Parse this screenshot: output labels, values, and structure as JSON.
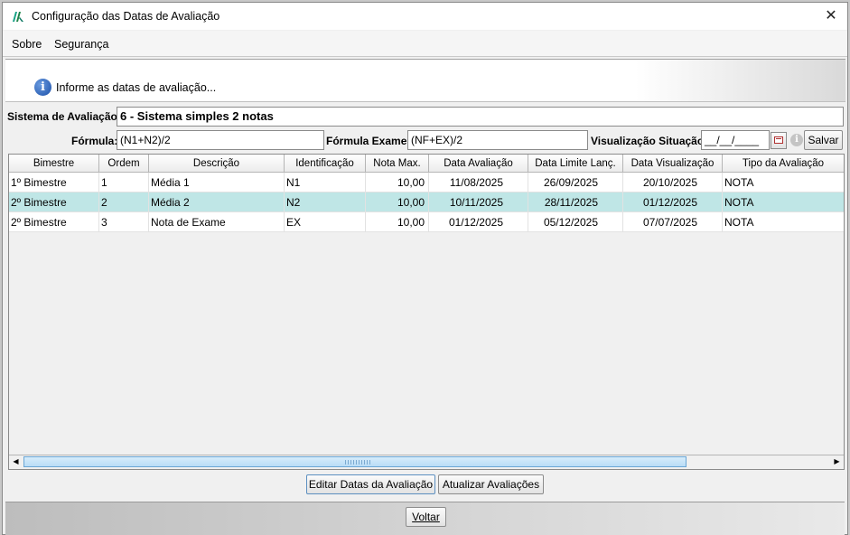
{
  "window": {
    "title": "Configuração das Datas de Avaliação",
    "close_icon": "close-icon"
  },
  "menu": {
    "items": [
      "Sobre",
      "Segurança"
    ]
  },
  "banner": {
    "text": "Informe as datas de avaliação..."
  },
  "form": {
    "sistema_label": "Sistema de Avaliação:",
    "sistema_value": "6 - Sistema simples 2 notas",
    "formula_label": "Fórmula:",
    "formula_value": "(N1+N2)/2",
    "formula_exame_label": "Fórmula Exame:",
    "formula_exame_value": "(NF+EX)/2",
    "visualizacao_label": "Visualização Situação:",
    "visualizacao_value": "__/__/____",
    "salvar_label": "Salvar"
  },
  "table": {
    "columns": [
      "Bimestre",
      "Ordem",
      "Descrição",
      "Identificação",
      "Nota Max.",
      "Data Avaliação",
      "Data Limite Lanç.",
      "Data Visualização",
      "Tipo da Avaliação"
    ],
    "rows": [
      [
        "1º Bimestre",
        "1",
        "Média 1",
        "N1",
        "10,00",
        "11/08/2025",
        "26/09/2025",
        "20/10/2025",
        "NOTA"
      ],
      [
        "2º Bimestre",
        "2",
        "Média 2",
        "N2",
        "10,00",
        "10/11/2025",
        "28/11/2025",
        "01/12/2025",
        "NOTA"
      ],
      [
        "2º Bimestre",
        "3",
        "Nota de Exame",
        "EX",
        "10,00",
        "01/12/2025",
        "05/12/2025",
        "07/07/2025",
        "NOTA"
      ]
    ],
    "selected_row": 2
  },
  "actions": {
    "editar_label": "Editar Datas da Avaliação",
    "atualizar_label": "Atualizar Avaliações"
  },
  "footer": {
    "voltar_label": "Voltar"
  }
}
